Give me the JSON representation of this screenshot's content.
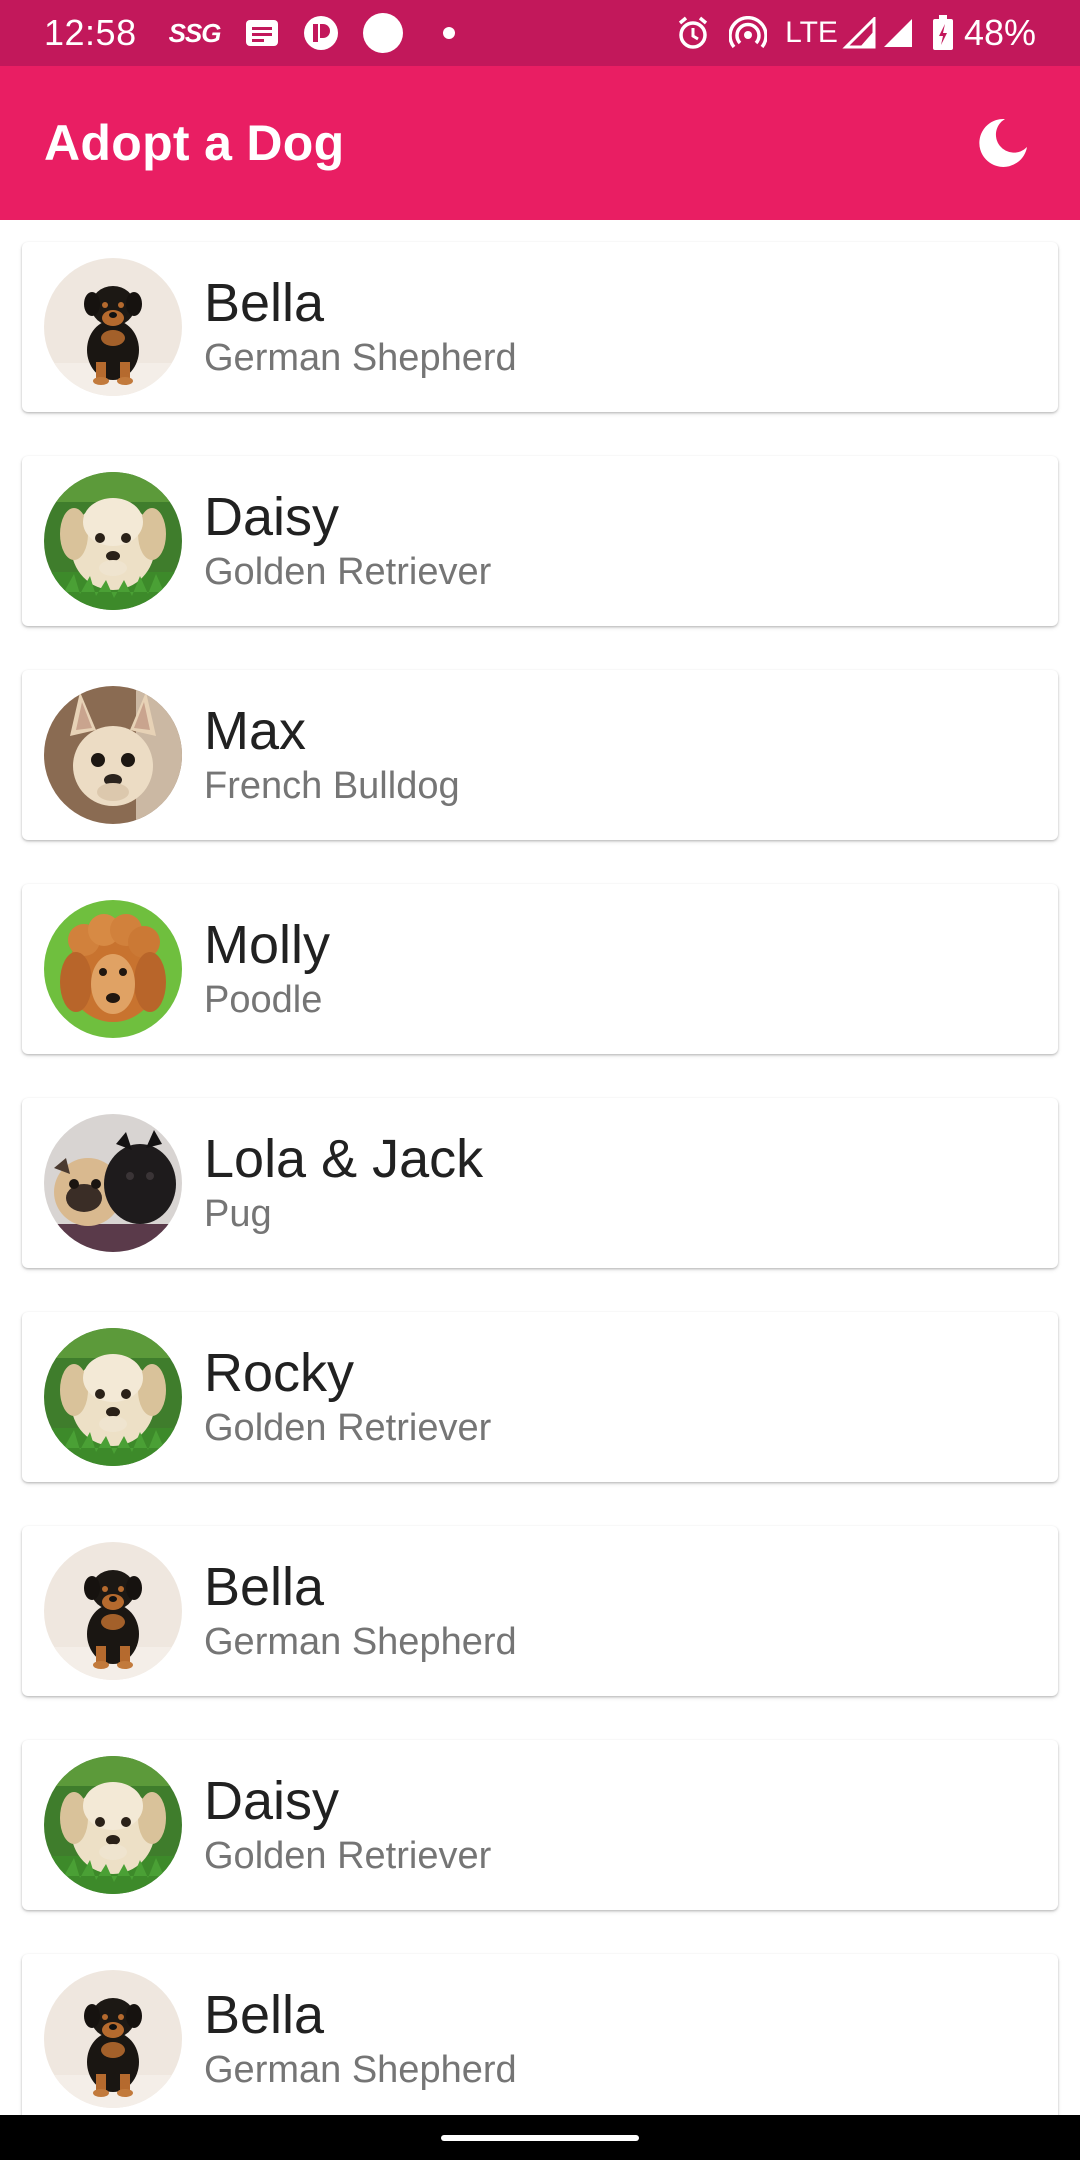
{
  "status_bar": {
    "time": "12:58",
    "carrier_icon_label": "SSG",
    "network": "LTE",
    "battery": "48%",
    "icons": [
      "message-icon",
      "app-icon",
      "circle-icon",
      "dot-icon",
      "alarm-icon",
      "hotspot-icon",
      "signal-icon",
      "battery-icon"
    ]
  },
  "app_bar": {
    "title": "Adopt a Dog",
    "theme_icon": "moon-icon"
  },
  "colors": {
    "status_bar": "#c2185b",
    "app_bar": "#e91e63",
    "name_text": "#212121",
    "breed_text": "#757575"
  },
  "dogs": [
    {
      "name": "Bella",
      "breed": "German Shepherd",
      "photo": "rottweiler-puppy"
    },
    {
      "name": "Daisy",
      "breed": "Golden Retriever",
      "photo": "golden-puppy"
    },
    {
      "name": "Max",
      "breed": "French Bulldog",
      "photo": "french-bulldog"
    },
    {
      "name": "Molly",
      "breed": "Poodle",
      "photo": "poodle"
    },
    {
      "name": "Lola & Jack",
      "breed": "Pug",
      "photo": "pugs"
    },
    {
      "name": "Rocky",
      "breed": "Golden Retriever",
      "photo": "golden-puppy"
    },
    {
      "name": "Bella",
      "breed": "German Shepherd",
      "photo": "rottweiler-puppy"
    },
    {
      "name": "Daisy",
      "breed": "Golden Retriever",
      "photo": "golden-puppy"
    },
    {
      "name": "Bella",
      "breed": "German Shepherd",
      "photo": "rottweiler-puppy"
    }
  ]
}
